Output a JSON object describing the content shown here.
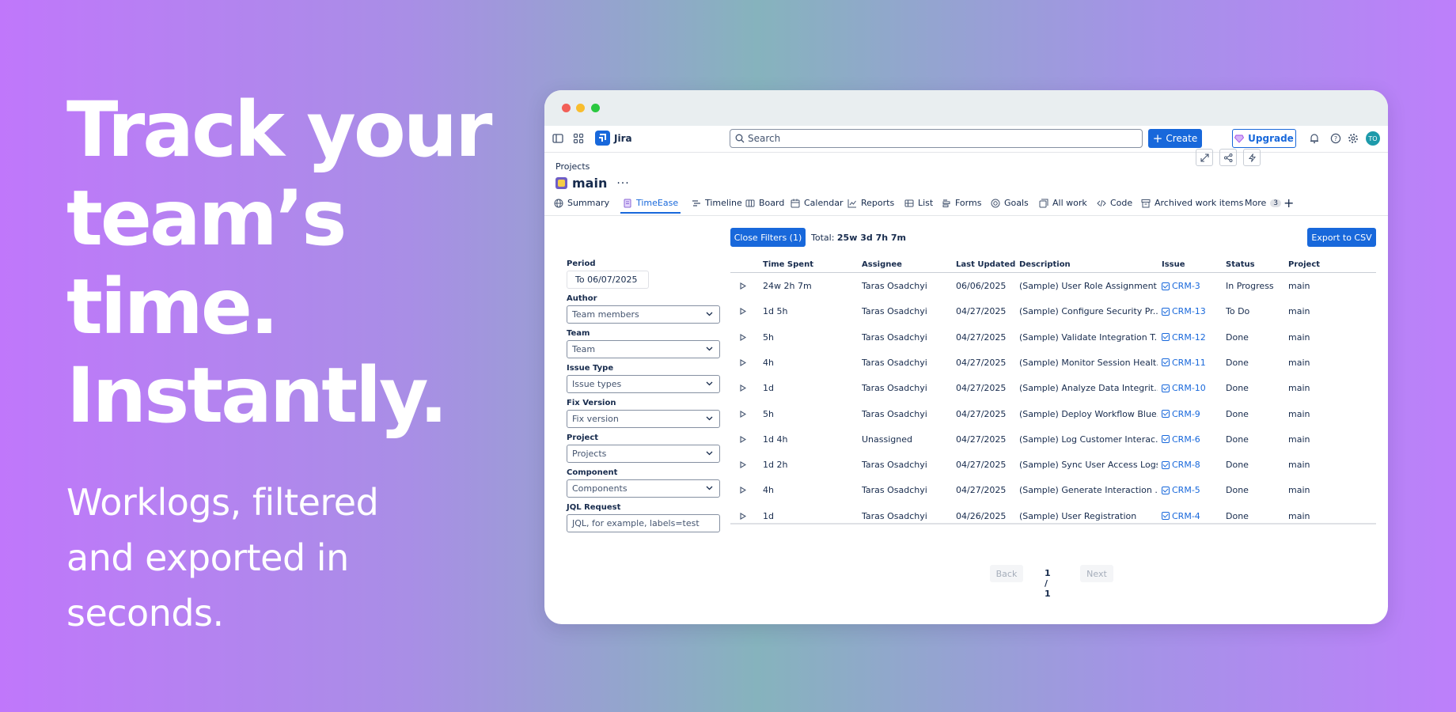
{
  "hero": {
    "title": "Track your\nteam’s\ntime.\nInstantly.",
    "subtitle": "Worklogs, filtered\nand exported in\nseconds."
  },
  "app": {
    "name": "Jira",
    "search_placeholder": "Search",
    "create_label": "Create",
    "upgrade_label": "Upgrade",
    "avatar_initials": "TO"
  },
  "project": {
    "breadcrumb": "Projects",
    "title": "main",
    "more": "···"
  },
  "tabs": {
    "summary": "Summary",
    "timeease": "TimeEase",
    "timeline": "Timeline",
    "board": "Board",
    "calendar": "Calendar",
    "reports": "Reports",
    "list": "List",
    "forms": "Forms",
    "goals": "Goals",
    "allwork": "All work",
    "code": "Code",
    "archived": "Archived work items",
    "more": "More",
    "more_count": "3"
  },
  "toolbar": {
    "close_filters": "Close Filters (1)",
    "total_label": "Total:",
    "total_value": "25w 3d 7h 7m",
    "export": "Export to CSV"
  },
  "filters": {
    "period_label": "Period",
    "period_value": "To 06/07/2025",
    "author_label": "Author",
    "author_value": "Team members",
    "team_label": "Team",
    "team_value": "Team",
    "issue_type_label": "Issue Type",
    "issue_type_value": "Issue types",
    "fix_version_label": "Fix Version",
    "fix_version_value": "Fix version",
    "project_label": "Project",
    "project_value": "Projects",
    "component_label": "Component",
    "component_value": "Components",
    "jql_label": "JQL Request",
    "jql_placeholder": "JQL, for example, labels=test"
  },
  "table": {
    "headers": {
      "time": "Time Spent",
      "assignee": "Assignee",
      "updated": "Last Updated",
      "description": "Description",
      "issue": "Issue",
      "status": "Status",
      "project": "Project"
    },
    "rows": [
      {
        "time": "24w 2h 7m",
        "assignee": "Taras Osadchyi",
        "updated": "06/06/2025",
        "description": "(Sample) User Role Assignment",
        "issue": "CRM-3",
        "status": "In Progress",
        "project": "main"
      },
      {
        "time": "1d 5h",
        "assignee": "Taras Osadchyi",
        "updated": "04/27/2025",
        "description": "(Sample) Configure Security Pr...",
        "issue": "CRM-13",
        "status": "To Do",
        "project": "main"
      },
      {
        "time": "5h",
        "assignee": "Taras Osadchyi",
        "updated": "04/27/2025",
        "description": "(Sample) Validate Integration T...",
        "issue": "CRM-12",
        "status": "Done",
        "project": "main"
      },
      {
        "time": "4h",
        "assignee": "Taras Osadchyi",
        "updated": "04/27/2025",
        "description": "(Sample) Monitor Session Healt...",
        "issue": "CRM-11",
        "status": "Done",
        "project": "main"
      },
      {
        "time": "1d",
        "assignee": "Taras Osadchyi",
        "updated": "04/27/2025",
        "description": "(Sample) Analyze Data Integrit...",
        "issue": "CRM-10",
        "status": "Done",
        "project": "main"
      },
      {
        "time": "5h",
        "assignee": "Taras Osadchyi",
        "updated": "04/27/2025",
        "description": "(Sample) Deploy Workflow Blue...",
        "issue": "CRM-9",
        "status": "Done",
        "project": "main"
      },
      {
        "time": "1d 4h",
        "assignee": "Unassigned",
        "updated": "04/27/2025",
        "description": "(Sample) Log Customer Interac...",
        "issue": "CRM-6",
        "status": "Done",
        "project": "main"
      },
      {
        "time": "1d 2h",
        "assignee": "Taras Osadchyi",
        "updated": "04/27/2025",
        "description": "(Sample) Sync User Access Logs",
        "issue": "CRM-8",
        "status": "Done",
        "project": "main"
      },
      {
        "time": "4h",
        "assignee": "Taras Osadchyi",
        "updated": "04/27/2025",
        "description": "(Sample) Generate Interaction ...",
        "issue": "CRM-5",
        "status": "Done",
        "project": "main"
      },
      {
        "time": "1d",
        "assignee": "Taras Osadchyi",
        "updated": "04/26/2025",
        "description": "(Sample) User Registration",
        "issue": "CRM-4",
        "status": "Done",
        "project": "main"
      }
    ]
  },
  "pager": {
    "back": "Back",
    "page": "1 / 1",
    "next": "Next"
  },
  "colors": {
    "accent": "#1868db",
    "text": "#172b4d"
  }
}
